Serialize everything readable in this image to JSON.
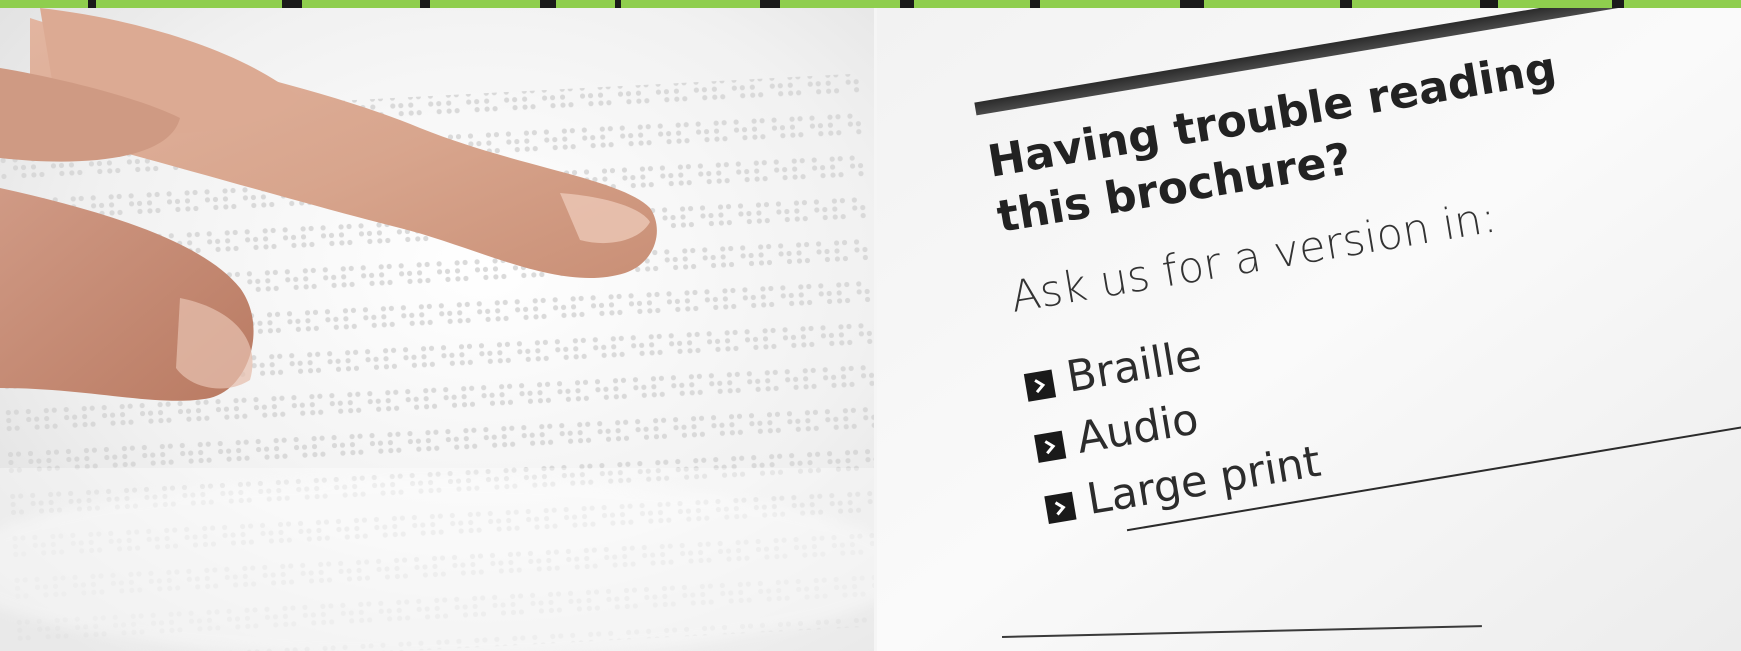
{
  "brochure": {
    "heading_line_1": "Having trouble reading",
    "heading_line_2": "this brochure?",
    "prompt": "Ask us for a version in:",
    "options": [
      {
        "label": "Braille",
        "icon": "chevron-right-icon"
      },
      {
        "label": "Audio",
        "icon": "chevron-right-icon"
      },
      {
        "label": "Large print",
        "icon": "chevron-right-icon"
      }
    ]
  },
  "colors": {
    "top_bar": "#8fce4e",
    "ink": "#222222",
    "paper": "#f7f7f7"
  }
}
